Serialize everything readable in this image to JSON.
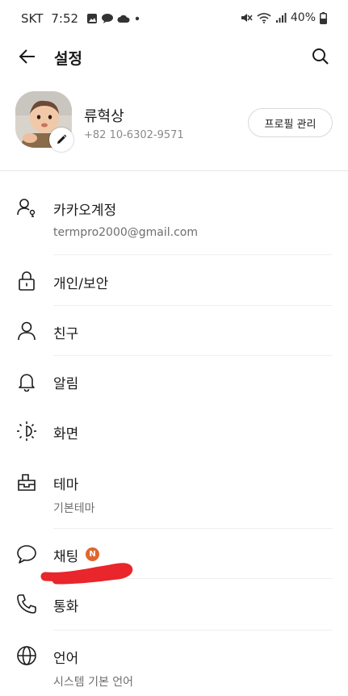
{
  "status_bar": {
    "carrier": "SKT",
    "time": "7:52",
    "battery": "40%",
    "left_icons": [
      "gallery-icon",
      "message-icon",
      "cloud-icon",
      "dot-icon"
    ],
    "right_icons": [
      "mute-icon",
      "wifi-icon",
      "signal-icon",
      "battery-icon"
    ]
  },
  "app_bar": {
    "title": "설정"
  },
  "profile": {
    "name": "류혁상",
    "phone": "+82 10-6302-9571",
    "manage_button": "프로필 관리"
  },
  "menu": {
    "items": [
      {
        "label": "카카오계정",
        "sub": "termpro2000@gmail.com",
        "icon": "account-icon"
      },
      {
        "label": "개인/보안",
        "sub": "",
        "icon": "lock-icon"
      },
      {
        "label": "친구",
        "sub": "",
        "icon": "person-icon"
      },
      {
        "label": "알림",
        "sub": "",
        "icon": "bell-icon"
      },
      {
        "label": "화면",
        "sub": "",
        "icon": "brightness-icon"
      },
      {
        "label": "테마",
        "sub": "기본테마",
        "icon": "theme-icon"
      },
      {
        "label": "채팅",
        "sub": "",
        "icon": "chat-bubble-icon",
        "badge": "N",
        "badge_color": "#e0662e"
      },
      {
        "label": "통화",
        "sub": "",
        "icon": "phone-icon"
      },
      {
        "label": "언어",
        "sub": "시스템 기본 언어",
        "icon": "globe-icon"
      }
    ]
  },
  "colors": {
    "badge": "#e0662e",
    "scribble": "#e8262b"
  }
}
